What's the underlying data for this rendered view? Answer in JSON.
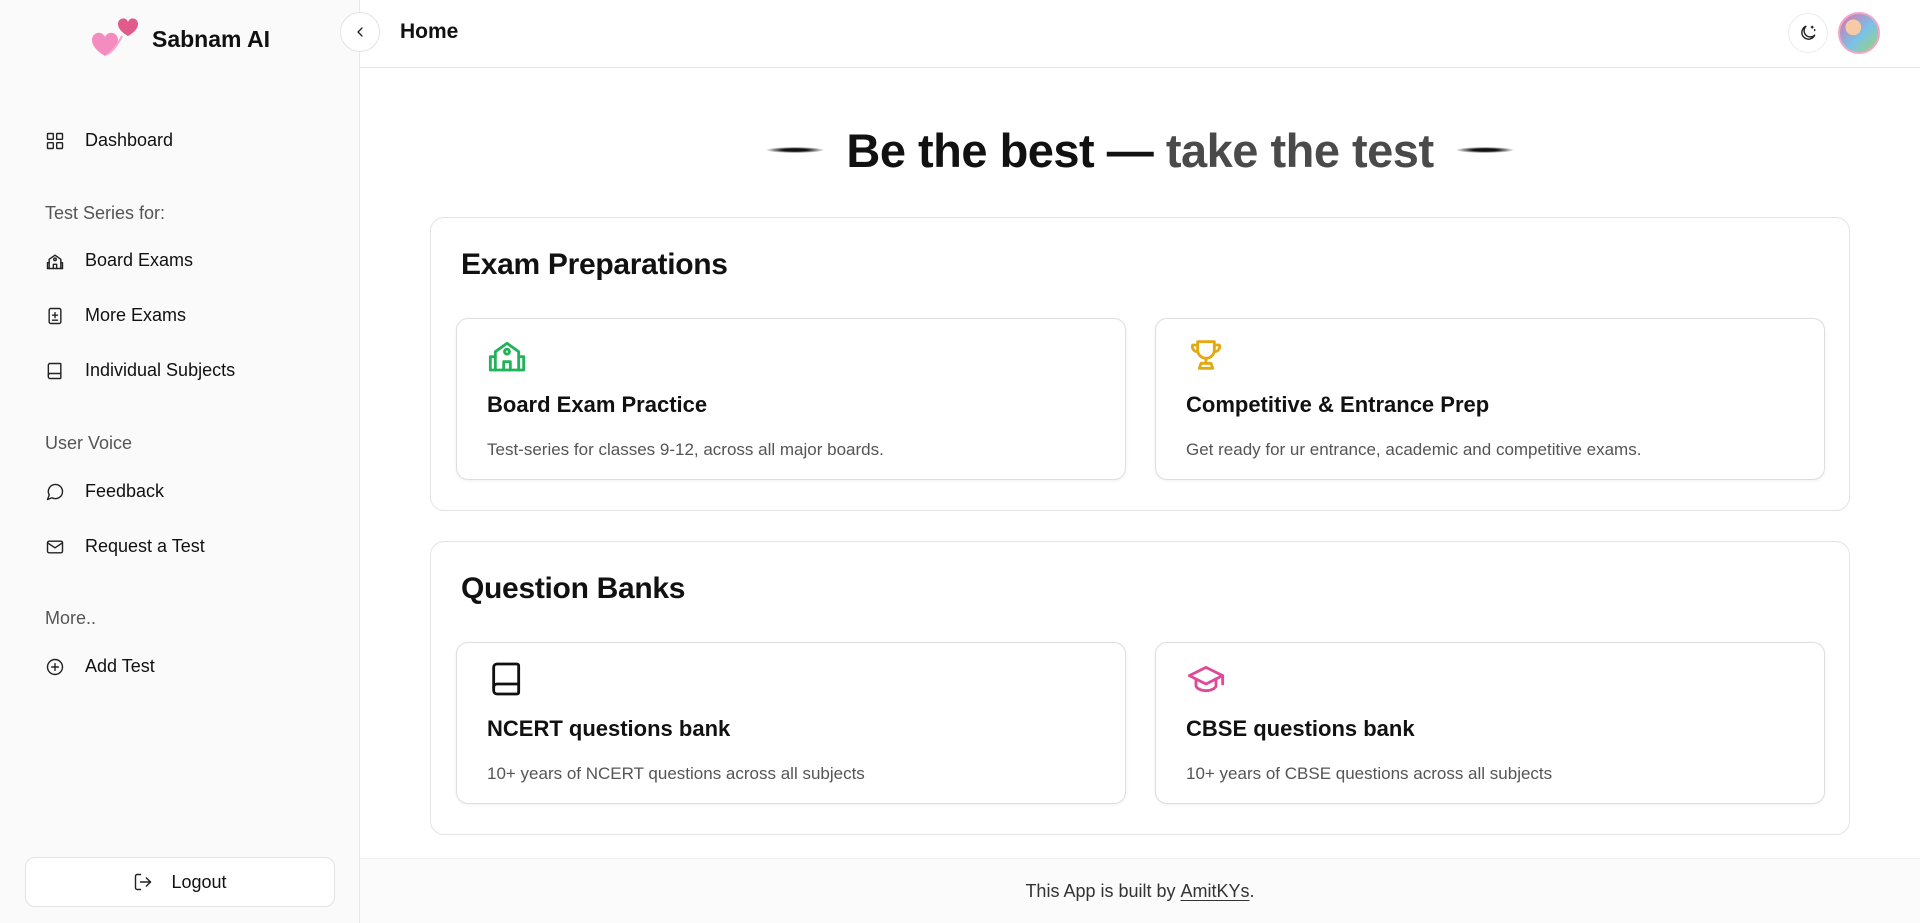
{
  "brand": {
    "name": "Sabnam AI",
    "logo_icon": "hearts-logo-icon"
  },
  "sidebar": {
    "dashboard": {
      "label": "Dashboard",
      "icon": "grid-icon"
    },
    "sections": [
      {
        "label": "Test Series for:"
      },
      {
        "label": "User Voice"
      },
      {
        "label": "More.."
      }
    ],
    "items": [
      {
        "label": "Board Exams",
        "icon": "school-icon"
      },
      {
        "label": "More Exams",
        "icon": "book-plus-icon"
      },
      {
        "label": "Individual Subjects",
        "icon": "notebook-icon"
      },
      {
        "label": "Feedback",
        "icon": "message-circle-icon"
      },
      {
        "label": "Request a Test",
        "icon": "mail-icon"
      },
      {
        "label": "Add Test",
        "icon": "plus-circle-icon"
      }
    ],
    "logout_label": "Logout"
  },
  "header": {
    "title": "Home",
    "theme_icon": "moon-icon"
  },
  "hero": {
    "part1": "Be the best — ",
    "part2": "take the test"
  },
  "panels": [
    {
      "title": "Exam Preparations",
      "cards": [
        {
          "title": "Board Exam Practice",
          "desc": "Test-series for classes 9-12, across all major boards.",
          "icon": "school-icon",
          "color": "#22b35a"
        },
        {
          "title": "Competitive & Entrance Prep",
          "desc": "Get ready for ur entrance, academic and competitive exams.",
          "icon": "trophy-icon",
          "color": "#e3a912"
        }
      ]
    },
    {
      "title": "Question Banks",
      "cards": [
        {
          "title": "NCERT questions bank",
          "desc": "10+ years of NCERT questions across all subjects",
          "icon": "book-icon",
          "color": "#111111"
        },
        {
          "title": "CBSE questions bank",
          "desc": "10+ years of CBSE questions across all subjects",
          "icon": "graduation-cap-icon",
          "color": "#e0489a"
        }
      ]
    }
  ],
  "footer": {
    "prefix": "This App is built by ",
    "link": "AmitKYs",
    "suffix": "."
  }
}
